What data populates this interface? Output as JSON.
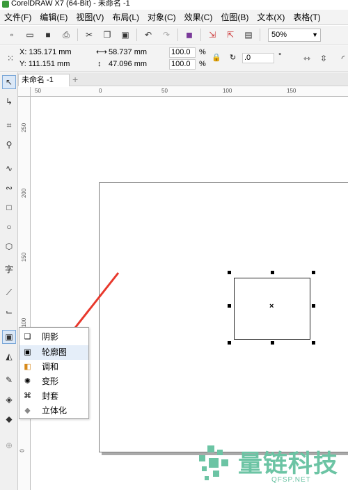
{
  "window": {
    "title": "CorelDRAW X7 (64-Bit) - 未命名 -1"
  },
  "menu": [
    "文件(F)",
    "编辑(E)",
    "视图(V)",
    "布局(L)",
    "对象(C)",
    "效果(C)",
    "位图(B)",
    "文本(X)",
    "表格(T)"
  ],
  "toolbar": {
    "zoom": "50%"
  },
  "properties": {
    "x": "X: 135.171 mm",
    "y": "Y: 111.151 mm",
    "width": "58.737 mm",
    "height": "47.096 mm",
    "scale_w": "100.0",
    "scale_h": "100.0",
    "percent": "%",
    "rotation": ".0",
    "degree": "°"
  },
  "document": {
    "tab": "未命名 -1"
  },
  "rulers": {
    "top": [
      "50",
      "0",
      "50",
      "100",
      "150"
    ],
    "left": [
      "250",
      "200",
      "150",
      "100",
      "0"
    ]
  },
  "flyout": {
    "items": [
      "阴影",
      "轮廓图",
      "调和",
      "变形",
      "封套",
      "立体化"
    ]
  },
  "watermark": {
    "text": "量链科技",
    "url": "QFSP.NET"
  },
  "colors": {
    "accent": "#e8382c",
    "selection": "#dbe8f7",
    "watermark": "#6cc4a4"
  }
}
